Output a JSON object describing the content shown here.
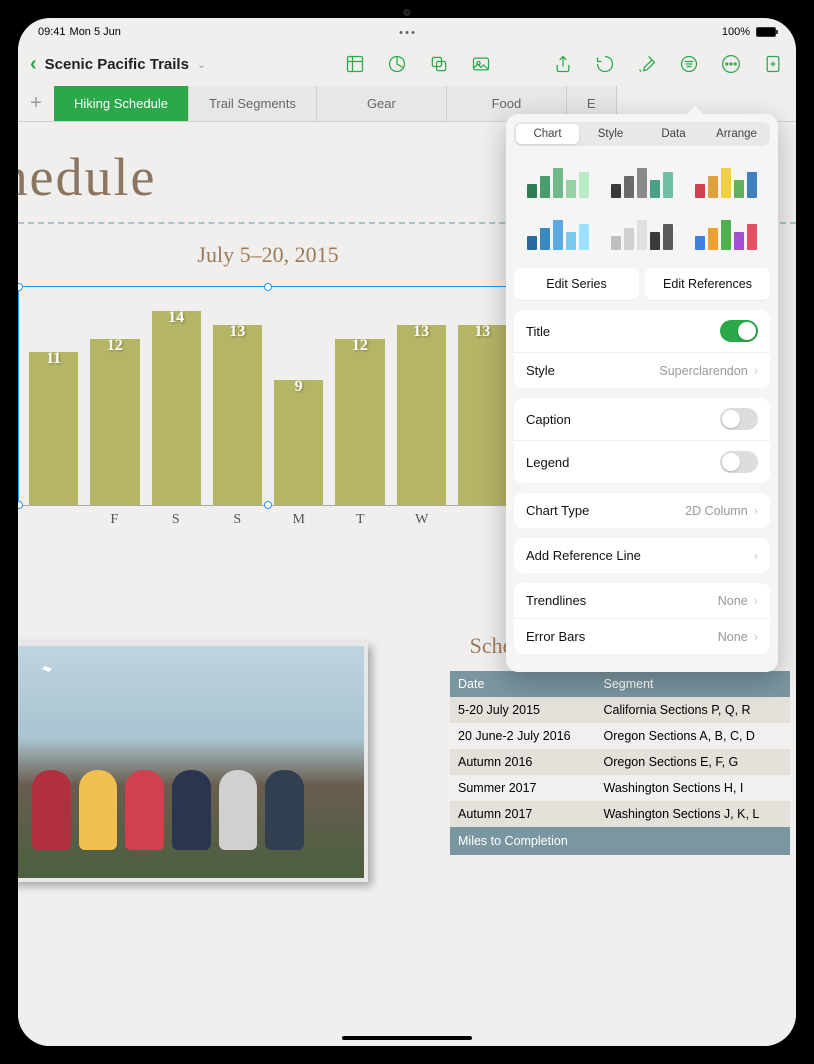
{
  "status": {
    "time": "09:41",
    "date": "Mon 5 Jun",
    "battery": "100%"
  },
  "doc": {
    "title": "Scenic Pacific Trails"
  },
  "tabs": [
    "Hiking Schedule",
    "Trail Segments",
    "Gear",
    "Food",
    "E"
  ],
  "heading": "g Schedule",
  "chart_data": {
    "type": "bar",
    "title": "July 5–20, 2015",
    "categories": [
      "",
      "F",
      "S",
      "S",
      "M",
      "T",
      "W",
      ""
    ],
    "values": [
      11,
      12,
      14,
      13,
      9,
      12,
      13,
      13
    ],
    "ylim": [
      0,
      15
    ],
    "color": "#b5b566"
  },
  "schedule": {
    "title": "Schedule for Completing the Trail",
    "columns": [
      "Date",
      "Segment"
    ],
    "rows": [
      [
        "5-20 July 2015",
        "California Sections P, Q, R"
      ],
      [
        "20 June-2 July 2016",
        "Oregon Sections A, B, C, D"
      ],
      [
        "Autumn 2016",
        "Oregon Sections E, F, G"
      ],
      [
        "Summer 2017",
        "Washington Sections H, I"
      ],
      [
        "Autumn 2017",
        "Washington Sections J, K, L"
      ]
    ],
    "footer": "Miles to Completion"
  },
  "popover": {
    "tabs": [
      "Chart",
      "Style",
      "Data",
      "Arrange"
    ],
    "edit_series": "Edit Series",
    "edit_refs": "Edit References",
    "rows": {
      "title": "Title",
      "style": "Style",
      "style_value": "Superclarendon",
      "caption": "Caption",
      "legend": "Legend",
      "chart_type": "Chart Type",
      "chart_type_value": "2D Column",
      "add_ref": "Add Reference Line",
      "trendlines": "Trendlines",
      "trendlines_value": "None",
      "error_bars": "Error Bars",
      "error_bars_value": "None"
    }
  },
  "people_colors": [
    "#b03040",
    "#f0c050",
    "#d04050",
    "#2a3550",
    "#d0d0d0",
    "#304050"
  ]
}
